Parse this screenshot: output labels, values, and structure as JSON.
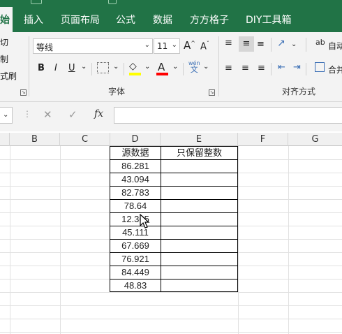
{
  "menu": {
    "tabs": [
      {
        "label": "始",
        "active": true
      },
      {
        "label": "插入"
      },
      {
        "label": "页面布局"
      },
      {
        "label": "公式"
      },
      {
        "label": "数据"
      },
      {
        "label": "方方格子"
      },
      {
        "label": "DIY工具箱"
      }
    ]
  },
  "ribbon": {
    "clipboard": {
      "cut_label": "切",
      "copy_label": "制",
      "format_painter_label": "式刷"
    },
    "font": {
      "font_name": "等线",
      "font_size": "11",
      "grow_label": "A",
      "shrink_label": "A",
      "bold_label": "B",
      "italic_label": "I",
      "underline_label": "U",
      "font_color_label": "A",
      "phonetic_top": "wén",
      "phonetic_bottom": "文",
      "group_label": "字体"
    },
    "alignment": {
      "wrap_label": "自动",
      "merge_label": "合并",
      "group_label": "对齐方式"
    },
    "colors": {
      "highlight": "#ffff00",
      "font_color": "#ff0000",
      "brand": "#217346"
    }
  },
  "formula_bar": {
    "fx_label": "fx",
    "cancel_symbol": "✕",
    "enter_symbol": "✓",
    "formula": ""
  },
  "sheet": {
    "columns": [
      "B",
      "C",
      "D",
      "E",
      "F",
      "G"
    ],
    "header_d": "源数据",
    "header_e": "只保留整数",
    "values": [
      "86.281",
      "43.094",
      "82.783",
      "78.64",
      "12.365",
      "45.111",
      "67.669",
      "76.921",
      "84.449",
      "48.83"
    ]
  }
}
